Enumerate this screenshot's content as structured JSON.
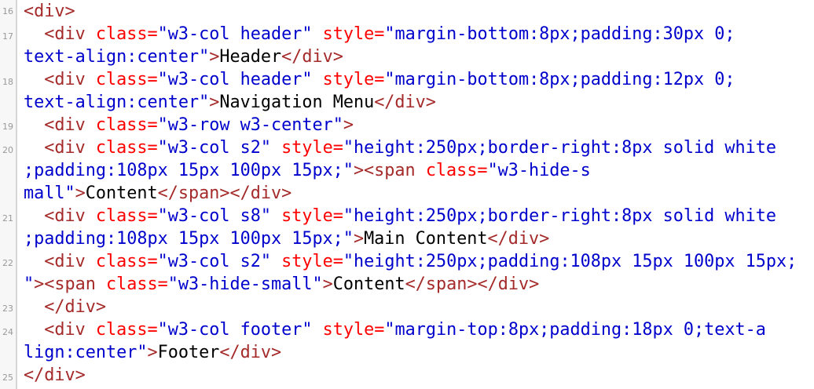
{
  "code": {
    "line_numbers": [
      "16",
      "17",
      "18",
      "19",
      "20",
      "21",
      "22",
      "23",
      "24",
      "25"
    ],
    "lines": [
      {
        "number": "16",
        "segments": [
          {
            "type": "tag",
            "text": "<div>"
          }
        ]
      },
      {
        "number": "17",
        "segments": [
          {
            "type": "tag",
            "text": "  <div "
          },
          {
            "type": "attr",
            "text": "class="
          },
          {
            "type": "val",
            "text": "\"w3-col header\""
          },
          {
            "type": "attr",
            "text": " style="
          },
          {
            "type": "val",
            "text": "\"margin-bottom:8px;padding:30px 0;text-align:center\""
          },
          {
            "type": "tag",
            "text": ">"
          },
          {
            "type": "text",
            "text": "Header"
          },
          {
            "type": "tag",
            "text": "</div>"
          }
        ]
      },
      {
        "number": "18",
        "segments": [
          {
            "type": "tag",
            "text": "  <div "
          },
          {
            "type": "attr",
            "text": "class="
          },
          {
            "type": "val",
            "text": "\"w3-col header\""
          },
          {
            "type": "attr",
            "text": " style="
          },
          {
            "type": "val",
            "text": "\"margin-bottom:8px;padding:12px 0;text-align:center\""
          },
          {
            "type": "tag",
            "text": ">"
          },
          {
            "type": "text",
            "text": "Navigation Menu"
          },
          {
            "type": "tag",
            "text": "</div>"
          }
        ]
      },
      {
        "number": "19",
        "segments": [
          {
            "type": "tag",
            "text": "  <div "
          },
          {
            "type": "attr",
            "text": "class="
          },
          {
            "type": "val",
            "text": "\"w3-row w3-center\""
          },
          {
            "type": "tag",
            "text": ">"
          }
        ]
      },
      {
        "number": "20",
        "segments": [
          {
            "type": "tag",
            "text": "  <div "
          },
          {
            "type": "attr",
            "text": "class="
          },
          {
            "type": "val",
            "text": "\"w3-col s2\""
          },
          {
            "type": "attr",
            "text": " style="
          },
          {
            "type": "val",
            "text": "\"height:250px;border-right:8px solid white;padding:108px 15px 100px 15px;\""
          },
          {
            "type": "tag",
            "text": "><span "
          },
          {
            "type": "attr",
            "text": "class="
          },
          {
            "type": "val",
            "text": "\"w3-hide-small\""
          },
          {
            "type": "tag",
            "text": ">"
          },
          {
            "type": "text",
            "text": "Content"
          },
          {
            "type": "tag",
            "text": "</span></div>"
          }
        ]
      },
      {
        "number": "21",
        "segments": [
          {
            "type": "tag",
            "text": "  <div "
          },
          {
            "type": "attr",
            "text": "class="
          },
          {
            "type": "val",
            "text": "\"w3-col s8\""
          },
          {
            "type": "attr",
            "text": " style="
          },
          {
            "type": "val",
            "text": "\"height:250px;border-right:8px solid white;padding:108px 15px 100px 15px;\""
          },
          {
            "type": "tag",
            "text": ">"
          },
          {
            "type": "text",
            "text": "Main Content"
          },
          {
            "type": "tag",
            "text": "</div>"
          }
        ]
      },
      {
        "number": "22",
        "segments": [
          {
            "type": "tag",
            "text": "  <div "
          },
          {
            "type": "attr",
            "text": "class="
          },
          {
            "type": "val",
            "text": "\"w3-col s2\""
          },
          {
            "type": "attr",
            "text": " style="
          },
          {
            "type": "val",
            "text": "\"height:250px;padding:108px 15px 100px 15px;\""
          },
          {
            "type": "tag",
            "text": "><span "
          },
          {
            "type": "attr",
            "text": "class="
          },
          {
            "type": "val",
            "text": "\"w3-hide-small\""
          },
          {
            "type": "tag",
            "text": ">"
          },
          {
            "type": "text",
            "text": "Content"
          },
          {
            "type": "tag",
            "text": "</span></div>"
          }
        ]
      },
      {
        "number": "23",
        "segments": [
          {
            "type": "tag",
            "text": "  </div>"
          }
        ]
      },
      {
        "number": "24",
        "segments": [
          {
            "type": "tag",
            "text": "  <div "
          },
          {
            "type": "attr",
            "text": "class="
          },
          {
            "type": "val",
            "text": "\"w3-col footer\""
          },
          {
            "type": "attr",
            "text": " style="
          },
          {
            "type": "val",
            "text": "\"margin-top:8px;padding:18px 0;text-align:center\""
          },
          {
            "type": "tag",
            "text": ">"
          },
          {
            "type": "text",
            "text": "Footer"
          },
          {
            "type": "tag",
            "text": "</div>"
          }
        ]
      },
      {
        "number": "25",
        "segments": [
          {
            "type": "tag",
            "text": "</div>"
          }
        ]
      }
    ]
  },
  "colors": {
    "tag": "#a52a2a",
    "attribute": "#ff0000",
    "value": "#0000cd",
    "text": "#000000",
    "gutter_background": "#f7f7f7",
    "line_number": "#9a9a9a"
  }
}
